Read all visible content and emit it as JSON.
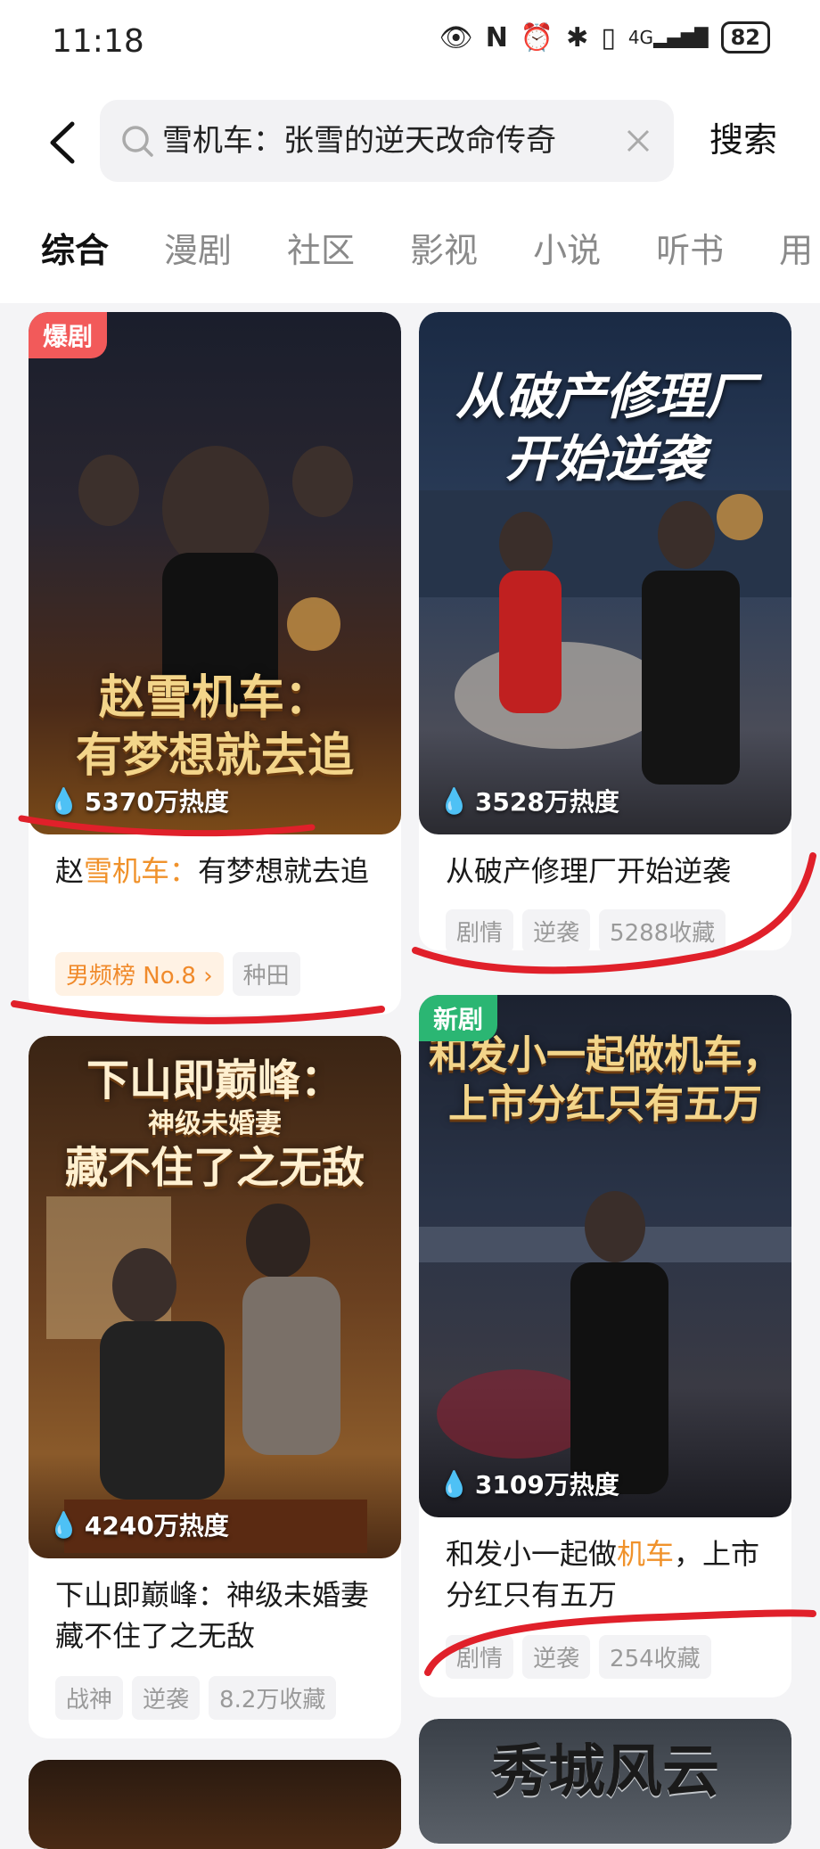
{
  "status_bar": {
    "time": "11:18",
    "battery": "82",
    "network": "4G"
  },
  "search": {
    "query": "雪机车：张雪的逆天改命传奇",
    "button": "搜索"
  },
  "tabs": [
    "综合",
    "漫剧",
    "社区",
    "影视",
    "小说",
    "听书",
    "用"
  ],
  "active_tab_index": 0,
  "cards": [
    {
      "badge": "爆剧",
      "badge_color": "#f25a5a",
      "poster_title_line1": "赵雪机车：",
      "poster_title_line2": "有梦想就去追",
      "heat": "5370万热度",
      "title_pre": "赵",
      "title_hl": "雪机车：",
      "title_post": "有梦想就去追",
      "tags": [
        "男频榜 No.8 ›",
        "种田"
      ]
    },
    {
      "poster_title_line1": "从破产修理厂",
      "poster_title_line2": "开始逆袭",
      "heat": "3528万热度",
      "title": "从破产修理厂开始逆袭",
      "tags": [
        "剧情",
        "逆袭",
        "5288收藏"
      ]
    },
    {
      "poster_title_line1": "下山即巅峰：",
      "poster_title_line2": "神级未婚妻",
      "poster_title_line3": "藏不住了之无敌",
      "heat": "4240万热度",
      "title": "下山即巅峰：神级未婚妻藏不住了之无敌",
      "tags": [
        "战神",
        "逆袭",
        "8.2万收藏"
      ]
    },
    {
      "badge": "新剧",
      "badge_color": "#2bb673",
      "poster_title_line1": "和发小一起做机车，",
      "poster_title_line2": "上市分红只有五万",
      "heat": "3109万热度",
      "title_pre": "和发小一起做",
      "title_hl": "机车",
      "title_post": "，上市分红只有五万",
      "tags": [
        "剧情",
        "逆袭",
        "254收藏"
      ]
    },
    {
      "poster_title_line1": "秀城风云"
    }
  ],
  "colors": {
    "accent": "#f0922b",
    "annotation": "#e0202a"
  }
}
